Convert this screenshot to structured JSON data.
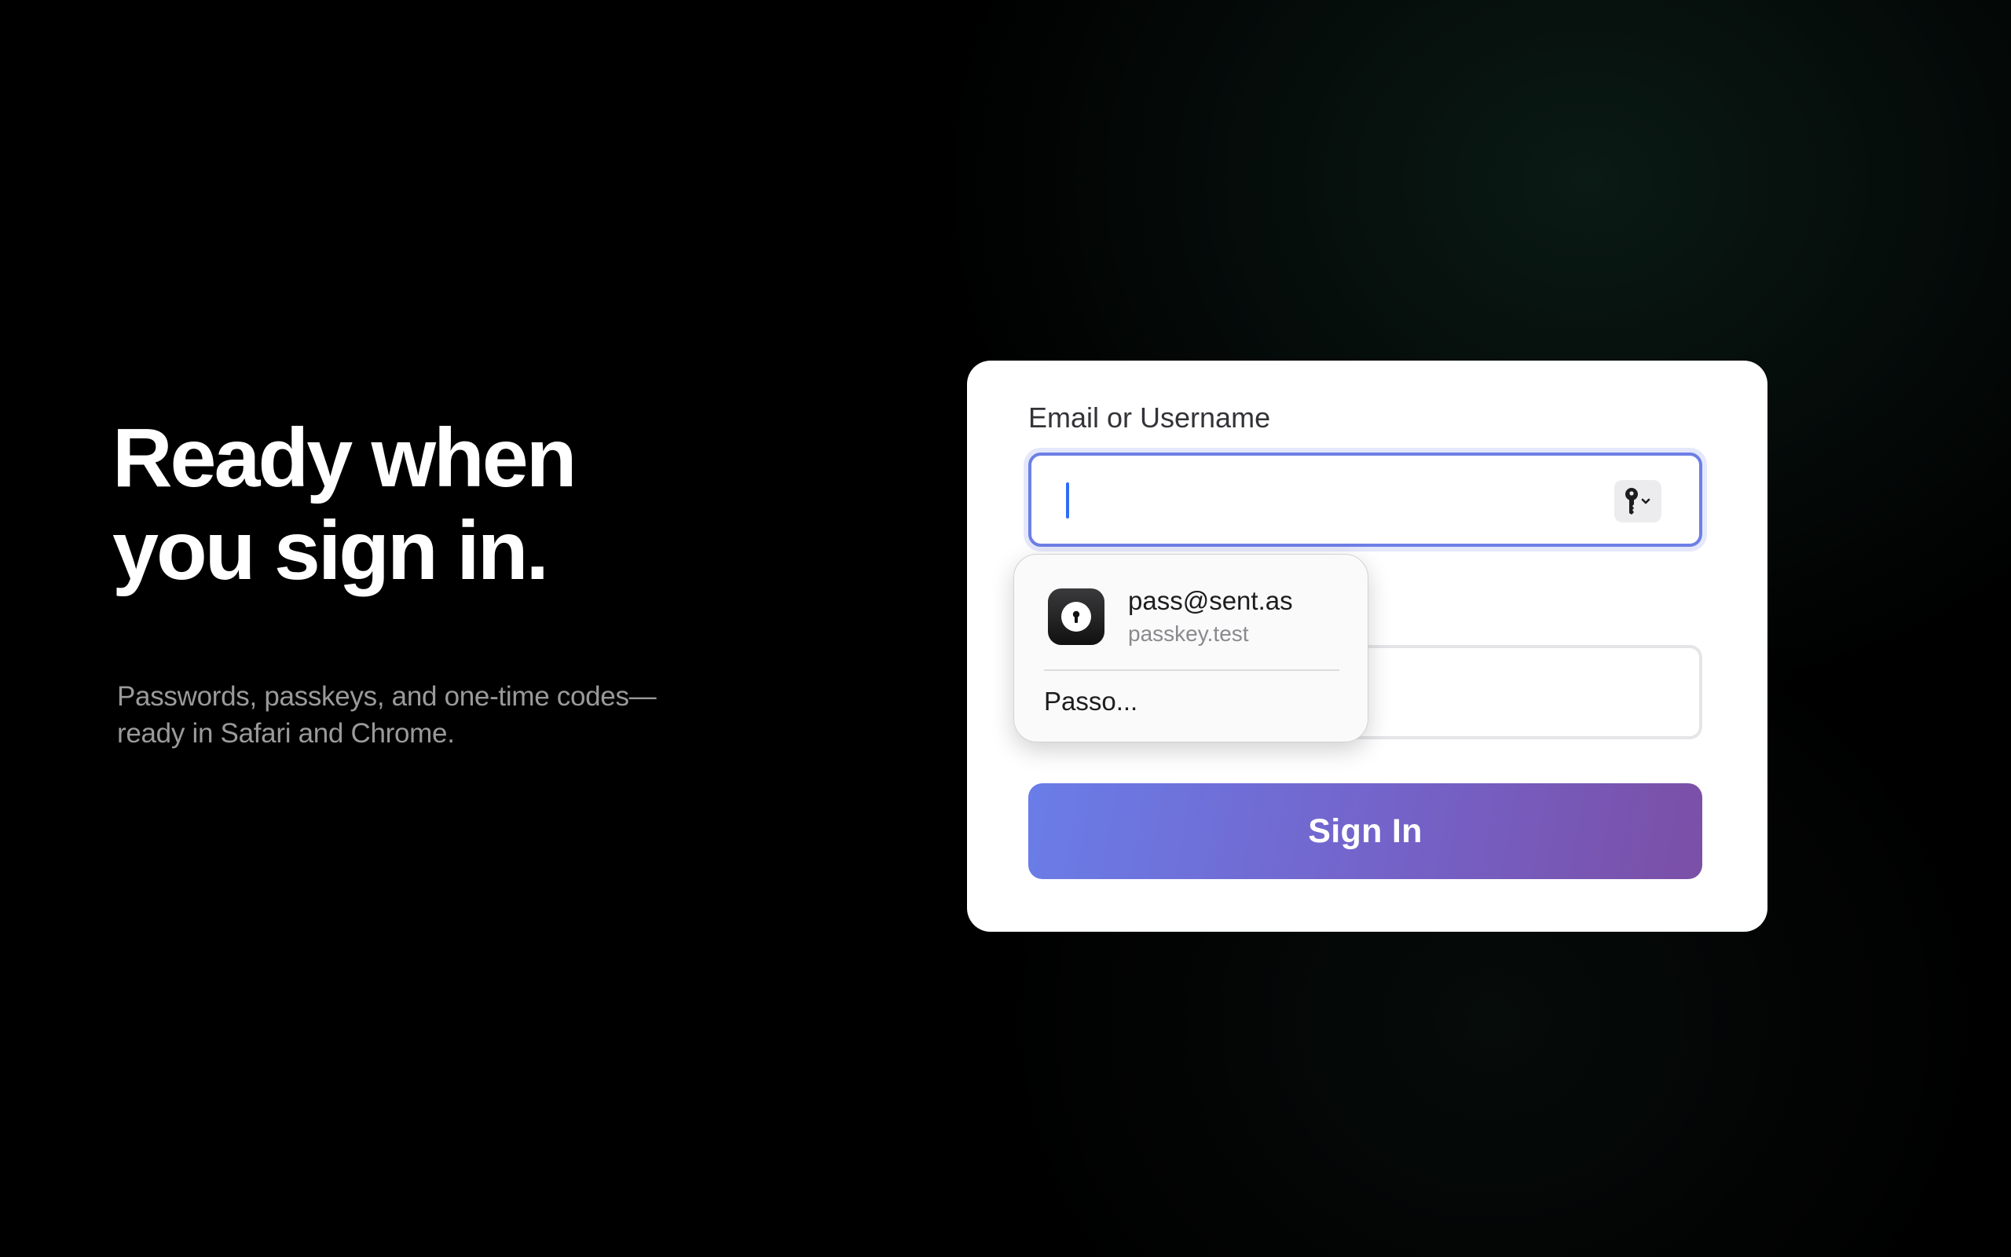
{
  "hero": {
    "title_line1": "Ready when",
    "title_line2": "you sign in.",
    "subtitle_line1": "Passwords, passkeys, and one-time codes—",
    "subtitle_line2": "ready in Safari and Chrome."
  },
  "form": {
    "email_label": "Email or Username",
    "email_value": "",
    "key_button_icon": "key-icon",
    "key_button_chevron": "chevron-down-icon",
    "password_value": "",
    "signin_label": "Sign In"
  },
  "autofill_popup": {
    "app_icon": "passwords-app-icon",
    "account": "pass@sent.as",
    "domain": "passkey.test",
    "passwords_label": "Passo..."
  },
  "colors": {
    "background": "#000000",
    "card": "#ffffff",
    "focus_ring": "#6d7fe6",
    "caret": "#2f6df5",
    "button_gradient_start": "#6a7de8",
    "button_gradient_end": "#7b4fa6",
    "hero_title": "#ffffff",
    "hero_subtitle": "#9a9a9a"
  }
}
